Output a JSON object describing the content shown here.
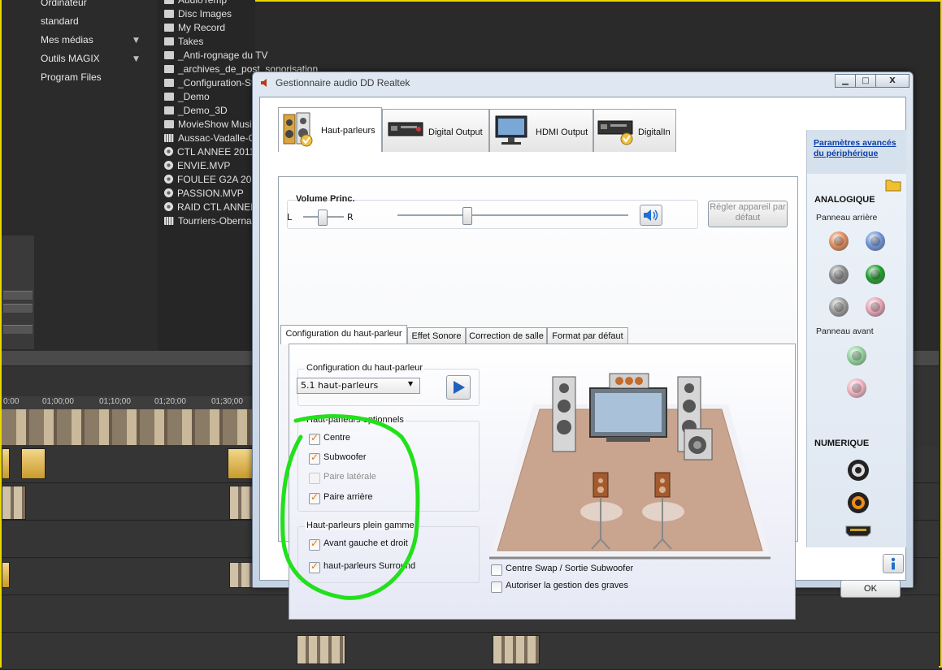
{
  "background_app": {
    "nav_items": [
      "Ordinateur",
      "standard",
      "Mes médias",
      "Outils MAGIX",
      "Program Files"
    ],
    "files": [
      {
        "name": "AudioTemp",
        "icon": "folder"
      },
      {
        "name": "Disc Images",
        "icon": "folder"
      },
      {
        "name": "My Record",
        "icon": "folder"
      },
      {
        "name": "Takes",
        "icon": "folder"
      },
      {
        "name": "_Anti-rognage du TV",
        "icon": "folder"
      },
      {
        "name": "_archives_de_post_sonorisation",
        "icon": "folder"
      },
      {
        "name": "_Configuration-St",
        "icon": "folder"
      },
      {
        "name": "_Demo",
        "icon": "folder"
      },
      {
        "name": "_Demo_3D",
        "icon": "folder"
      },
      {
        "name": "MovieShow Music",
        "icon": "folder"
      },
      {
        "name": "Aussac-Vadalle-Ol",
        "icon": "film"
      },
      {
        "name": "CTL ANNEE 2011 V",
        "icon": "disc"
      },
      {
        "name": "ENVIE.MVP",
        "icon": "disc"
      },
      {
        "name": "FOULEE G2A 2011",
        "icon": "disc"
      },
      {
        "name": "PASSION.MVP",
        "icon": "disc"
      },
      {
        "name": "RAID CTL ANNEE 2",
        "icon": "disc"
      },
      {
        "name": "Tourriers-Obernai",
        "icon": "film"
      }
    ],
    "ruler_ticks": [
      "0:00",
      "01;00;00",
      "01;10;00",
      "01;20;00",
      "01;30;00"
    ]
  },
  "dialog": {
    "title": "Gestionnaire audio DD Realtek",
    "window_buttons": {
      "minimize": "▁",
      "maximize": "□",
      "close": "X"
    },
    "tabs": [
      {
        "label": "Haut-parleurs",
        "icon": "speaker-icon",
        "active": true
      },
      {
        "label": "Digital Output",
        "icon": "digital-output-icon",
        "active": false
      },
      {
        "label": "HDMI Output",
        "icon": "hdmi-monitor-icon",
        "active": false
      },
      {
        "label": "DigitalIn",
        "icon": "digital-in-icon",
        "active": false
      }
    ],
    "volume": {
      "label": "Volume Princ.",
      "left": "L",
      "right": "R",
      "balance": 0.5,
      "level": 0.3,
      "default_device_button": "Régler appareil par défaut"
    },
    "subtabs": [
      "Configuration du haut-parleur",
      "Effet Sonore",
      "Correction de salle",
      "Format par défaut"
    ],
    "speaker_config": {
      "group_label": "Configuration du haut-parleur",
      "selected": "5.1 haut-parleurs"
    },
    "optional_speakers": {
      "label": "Haut-parleurs optionnels",
      "items": [
        {
          "label": "Centre",
          "checked": true,
          "disabled": false
        },
        {
          "label": "Subwoofer",
          "checked": true,
          "disabled": false
        },
        {
          "label": "Paire latérale",
          "checked": false,
          "disabled": true
        },
        {
          "label": "Paire arrière",
          "checked": true,
          "disabled": false
        }
      ]
    },
    "full_range_speakers": {
      "label": "Haut-parleurs plein gamme",
      "items": [
        {
          "label": "Avant gauche et droit",
          "checked": true
        },
        {
          "label": "haut-parleurs Surround",
          "checked": true
        }
      ]
    },
    "bottom_options": [
      {
        "label": "Centre Swap / Sortie Subwoofer",
        "checked": false
      },
      {
        "label": "Autoriser la gestion des graves",
        "checked": false
      }
    ],
    "side_panel": {
      "link": "Paramètres avancés du périphérique",
      "analog_title": "ANALOGIQUE",
      "rear_panel": "Panneau arrière",
      "front_panel": "Panneau avant",
      "digital_title": "NUMERIQUE",
      "rear_jack_colors": [
        "#e08a5a",
        "#6f93d6",
        "#8a8a8a",
        "#1e9a2a",
        "#9a9a9a",
        "#e6a3b3"
      ],
      "front_jack_colors": [
        "#8fd29a",
        "#f0b0bd"
      ]
    },
    "ok_button": "OK",
    "info_icon": "info-icon"
  }
}
